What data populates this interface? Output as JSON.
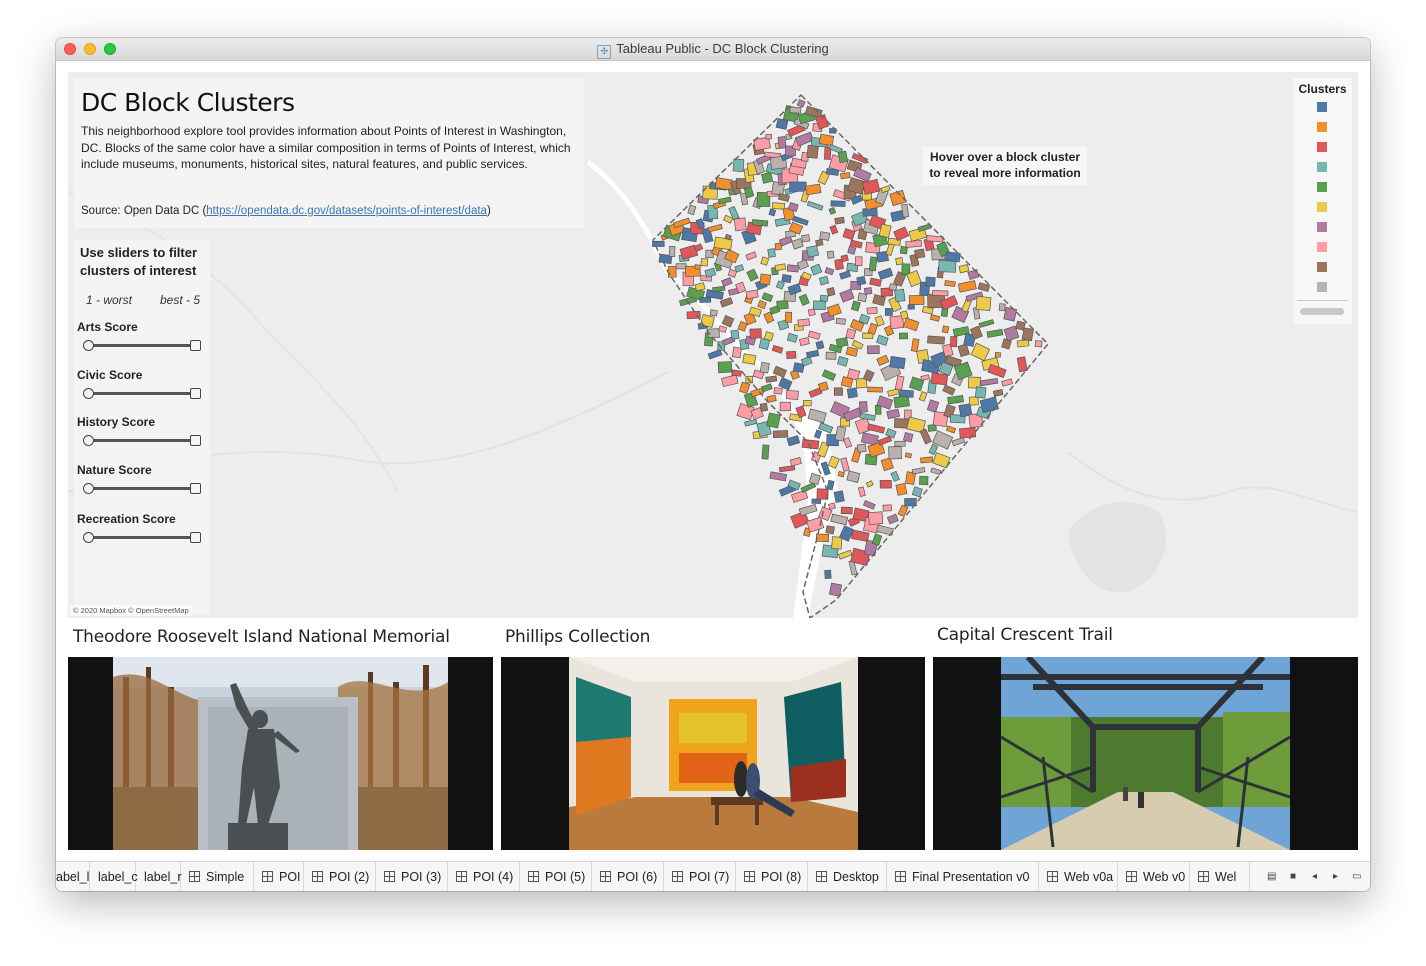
{
  "window": {
    "title": "Tableau Public - DC Block Clustering"
  },
  "dashboard": {
    "title": "DC Block Clusters",
    "description": "This neighborhood explore tool provides information about Points of Interest in Washington, DC.  Blocks of the same color have a similar composition in terms of Points of Interest, which include museums, monuments, historical sites, natural features, and public services.",
    "source_label": "Source:  Open Data DC (",
    "source_url": "https://opendata.dc.gov/datasets/points-of-interest/data",
    "source_close": ")",
    "hover_tip": "Hover over a block cluster to reveal more information",
    "attribution": "© 2020 Mapbox © OpenStreetMap"
  },
  "filters": {
    "title": "Use sliders to filter clusters of interest",
    "scale_low": "1 - worst",
    "scale_high": "best - 5",
    "sliders": [
      {
        "label": "Arts Score",
        "min": 1,
        "max": 5
      },
      {
        "label": "Civic Score",
        "min": 1,
        "max": 5
      },
      {
        "label": "History Score",
        "min": 1,
        "max": 5
      },
      {
        "label": "Nature Score",
        "min": 1,
        "max": 5
      },
      {
        "label": "Recreation Score",
        "min": 1,
        "max": 5
      }
    ]
  },
  "legend": {
    "title": "Clusters",
    "colors": [
      "#4e79a7",
      "#f28e2b",
      "#e15759",
      "#76b7b2",
      "#59a14f",
      "#edc948",
      "#b07aa1",
      "#ff9da7",
      "#9c755f",
      "#bab0ac"
    ]
  },
  "pois": [
    {
      "title": "Theodore Roosevelt Island National Memorial"
    },
    {
      "title": "Phillips Collection"
    },
    {
      "title": "Capital Crescent Trail"
    }
  ],
  "tabs": [
    {
      "label": "abel_l",
      "icon": false
    },
    {
      "label": "label_c",
      "icon": false
    },
    {
      "label": "label_r",
      "icon": false
    },
    {
      "label": "Simple",
      "icon": true
    },
    {
      "label": "POI",
      "icon": true
    },
    {
      "label": "POI (2)",
      "icon": true
    },
    {
      "label": "POI (3)",
      "icon": true
    },
    {
      "label": "POI (4)",
      "icon": true
    },
    {
      "label": "POI (5)",
      "icon": true
    },
    {
      "label": "POI (6)",
      "icon": true
    },
    {
      "label": "POI (7)",
      "icon": true
    },
    {
      "label": "POI (8)",
      "icon": true
    },
    {
      "label": "Desktop",
      "icon": true
    },
    {
      "label": "Final Presentation v0",
      "icon": true
    },
    {
      "label": "Web v0a",
      "icon": true
    },
    {
      "label": "Web v0",
      "icon": true
    },
    {
      "label": "Wel",
      "icon": true
    }
  ]
}
